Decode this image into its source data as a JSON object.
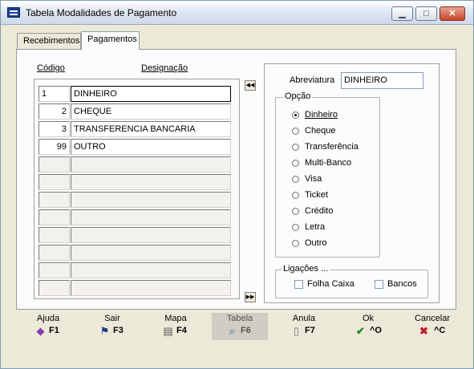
{
  "window": {
    "title": "Tabela Modalidades de Pagamento",
    "controls": {
      "minimize": "▁",
      "maximize": "□",
      "close": "✕"
    }
  },
  "tabs": [
    {
      "label": "Recebimentos",
      "active": false
    },
    {
      "label": "Pagamentos",
      "active": true
    }
  ],
  "grid": {
    "headers": {
      "code": "Código",
      "designation": "Designação"
    },
    "rows": [
      {
        "code": "1",
        "designation": "DINHEIRO"
      },
      {
        "code": "2",
        "designation": "CHEQUE"
      },
      {
        "code": "3",
        "designation": "TRANSFERENCIA BANCARIA"
      },
      {
        "code": "99",
        "designation": "OUTRO"
      },
      {
        "code": "",
        "designation": ""
      },
      {
        "code": "",
        "designation": ""
      },
      {
        "code": "",
        "designation": ""
      },
      {
        "code": "",
        "designation": ""
      },
      {
        "code": "",
        "designation": ""
      },
      {
        "code": "",
        "designation": ""
      },
      {
        "code": "",
        "designation": ""
      },
      {
        "code": "",
        "designation": ""
      }
    ],
    "nav_first": "◀◀",
    "nav_last": "▶▶"
  },
  "details": {
    "abreviatura_label": "Abreviatura",
    "abreviatura_value": "DINHEIRO",
    "opcao_label": "Opção",
    "options": [
      {
        "label": "Dinheiro",
        "checked": true
      },
      {
        "label": "Cheque",
        "checked": false
      },
      {
        "label": "Transferência",
        "checked": false
      },
      {
        "label": "Multi-Banco",
        "checked": false
      },
      {
        "label": "Visa",
        "checked": false
      },
      {
        "label": "Ticket",
        "checked": false
      },
      {
        "label": "Crédito",
        "checked": false
      },
      {
        "label": "Letra",
        "checked": false
      },
      {
        "label": "Outro",
        "checked": false
      }
    ],
    "ligacoes_label": "Ligações ...",
    "folha_caixa_label": "Folha Caixa",
    "bancos_label": "Bancos"
  },
  "toolbar": [
    {
      "label": "Ajuda",
      "key": "F1",
      "icon": "help-book-icon"
    },
    {
      "label": "Sair",
      "key": "F3",
      "icon": "exit-door-icon"
    },
    {
      "label": "Mapa",
      "key": "F4",
      "icon": "printer-icon"
    },
    {
      "label": "Tabela",
      "key": "F6",
      "icon": "table-search-icon"
    },
    {
      "label": "Anula",
      "key": "F7",
      "icon": "trash-icon"
    },
    {
      "label": "Ok",
      "key": "^O",
      "icon": "checkmark-icon"
    },
    {
      "label": "Cancelar",
      "key": "^C",
      "icon": "cancel-x-icon"
    }
  ],
  "colors": {
    "window_bg": "#ece9d8",
    "panel_bg": "#fcfcfe",
    "ok_green": "#1a8a1a",
    "cancel_red": "#c0202a"
  }
}
